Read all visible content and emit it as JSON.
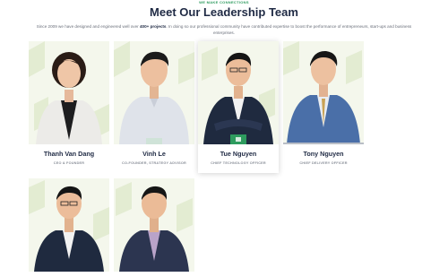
{
  "header": {
    "eyebrow": "WE MAKE CONNECTIONS",
    "title": "Meet Our Leadership Team",
    "intro_prefix": "Since 2009 we have designed and engineered well over ",
    "intro_bold": "400+ projects",
    "intro_suffix": ". In doing so our professional community have contributed expertise to boost the performance of entrepreneurs, start-ups and business enterprises."
  },
  "team": [
    {
      "name": "Thanh Van Dang",
      "role": "CEO & FOUNDER"
    },
    {
      "name": "Vinh Le",
      "role": "CO-FOUNDER, STRATEGY ADVISOR"
    },
    {
      "name": "Tue Nguyen",
      "role": "CHIEF TECHNOLOGY OFFICER"
    },
    {
      "name": "Tony Nguyen",
      "role": "CHIEF DELIVERY OFFICER"
    },
    {
      "name": "",
      "role": ""
    },
    {
      "name": "",
      "role": ""
    }
  ],
  "colors": {
    "accent": "#2e9b5e",
    "heading": "#1f2a44",
    "photo_bg": "#f4f7ec",
    "pattern": "#e3ecd2"
  }
}
